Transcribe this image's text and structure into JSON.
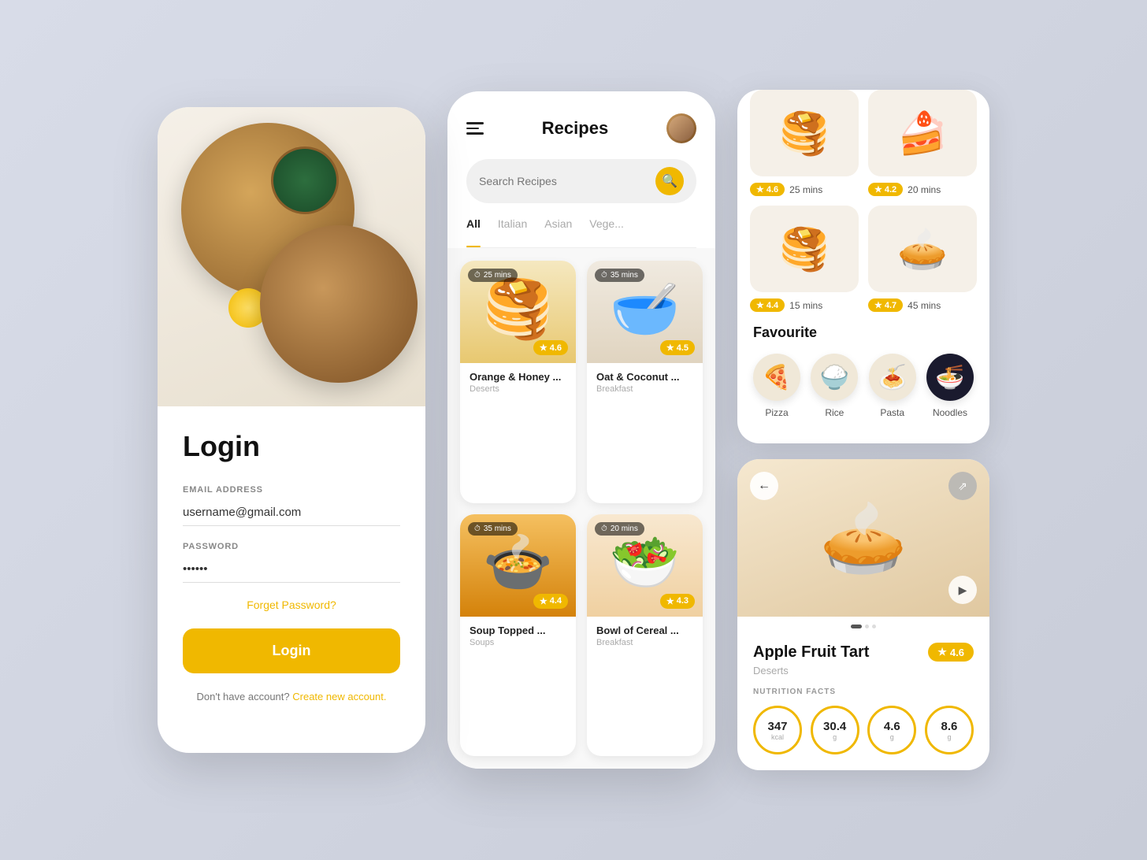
{
  "login": {
    "title": "Login",
    "email_label": "EMAIL ADDRESS",
    "email_value": "username@gmail.com",
    "password_label": "PASSWORD",
    "password_value": "••••••",
    "forgot_label": "Forget Password?",
    "button_label": "Login",
    "no_account_text": "Don't have account?",
    "create_account_label": "Create new account."
  },
  "recipes": {
    "title": "Recipes",
    "search_placeholder": "Search Recipes",
    "tabs": [
      {
        "label": "All",
        "active": true
      },
      {
        "label": "Italian",
        "active": false
      },
      {
        "label": "Asian",
        "active": false
      },
      {
        "label": "Vege...",
        "active": false
      }
    ],
    "cards": [
      {
        "name": "Orange & Honey ...",
        "category": "Deserts",
        "time": "25 mins",
        "rating": "4.6",
        "emoji": "🥞"
      },
      {
        "name": "Oat & Coconut ...",
        "category": "Breakfast",
        "time": "35 mins",
        "rating": "4.5",
        "emoji": "🥣"
      },
      {
        "name": "Soup Topped ...",
        "category": "Soups",
        "time": "35 mins",
        "rating": "4.4",
        "emoji": "🍲"
      },
      {
        "name": "Bowl of Cereal ...",
        "category": "Breakfast",
        "time": "20 mins",
        "rating": "4.3",
        "emoji": "🥗"
      }
    ]
  },
  "recipe_list": {
    "items": [
      {
        "rating": "4.6",
        "time": "25 mins",
        "emoji": "🥞"
      },
      {
        "rating": "4.2",
        "time": "20 mins",
        "emoji": "🍰"
      },
      {
        "rating": "4.4",
        "time": "15 mins",
        "emoji": "🥞"
      },
      {
        "rating": "4.7",
        "time": "45 mins",
        "emoji": "🥧"
      }
    ]
  },
  "favourites": {
    "title": "Favourite",
    "items": [
      {
        "label": "Pizza",
        "emoji": "🍕"
      },
      {
        "label": "Rice",
        "emoji": "🍚"
      },
      {
        "label": "Pasta",
        "emoji": "🍝"
      },
      {
        "label": "Noodles",
        "emoji": "🍜",
        "dark": true
      }
    ]
  },
  "detail": {
    "name": "Apple Fruit Tart",
    "category": "Deserts",
    "rating": "4.6",
    "emoji": "🥧",
    "nutrition_title": "NUTRITION FACTS",
    "nutrition": [
      {
        "value": "347",
        "unit": "kcal"
      },
      {
        "value": "30.4",
        "unit": "g"
      },
      {
        "value": "4.6",
        "unit": "g"
      },
      {
        "value": "8.6",
        "unit": "g"
      }
    ]
  },
  "colors": {
    "primary": "#f0b800",
    "background": "#d4d8e4"
  }
}
